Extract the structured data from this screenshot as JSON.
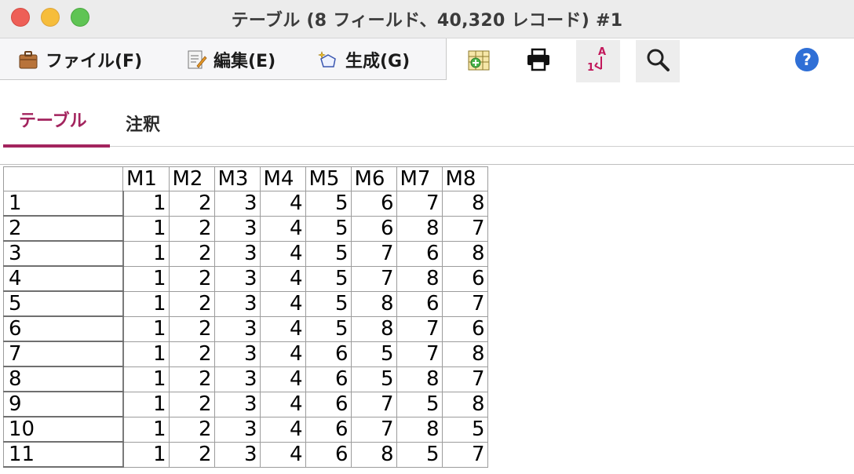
{
  "window": {
    "title": "テーブル (8 フィールド、40,320 レコード) #1"
  },
  "menu": {
    "file_label": "ファイル(F)",
    "edit_label": "編集(E)",
    "generate_label": "生成(G)"
  },
  "toolbar_icons": [
    "export-table-icon",
    "print-icon",
    "sort-icon",
    "search-icon",
    "help-icon"
  ],
  "tabs": [
    {
      "label": "テーブル",
      "active": true
    },
    {
      "label": "注釈",
      "active": false
    }
  ],
  "table": {
    "columns": [
      "M1",
      "M2",
      "M3",
      "M4",
      "M5",
      "M6",
      "M7",
      "M8"
    ],
    "rows": [
      {
        "label": "1",
        "values": [
          "1",
          "2",
          "3",
          "4",
          "5",
          "6",
          "7",
          "8"
        ]
      },
      {
        "label": "2",
        "values": [
          "1",
          "2",
          "3",
          "4",
          "5",
          "6",
          "8",
          "7"
        ]
      },
      {
        "label": "3",
        "values": [
          "1",
          "2",
          "3",
          "4",
          "5",
          "7",
          "6",
          "8"
        ]
      },
      {
        "label": "4",
        "values": [
          "1",
          "2",
          "3",
          "4",
          "5",
          "7",
          "8",
          "6"
        ]
      },
      {
        "label": "5",
        "values": [
          "1",
          "2",
          "3",
          "4",
          "5",
          "8",
          "6",
          "7"
        ]
      },
      {
        "label": "6",
        "values": [
          "1",
          "2",
          "3",
          "4",
          "5",
          "8",
          "7",
          "6"
        ]
      },
      {
        "label": "7",
        "values": [
          "1",
          "2",
          "3",
          "4",
          "6",
          "5",
          "7",
          "8"
        ]
      },
      {
        "label": "8",
        "values": [
          "1",
          "2",
          "3",
          "4",
          "6",
          "5",
          "8",
          "7"
        ]
      },
      {
        "label": "9",
        "values": [
          "1",
          "2",
          "3",
          "4",
          "6",
          "7",
          "5",
          "8"
        ]
      },
      {
        "label": "10",
        "values": [
          "1",
          "2",
          "3",
          "4",
          "6",
          "7",
          "8",
          "5"
        ]
      },
      {
        "label": "11",
        "values": [
          "1",
          "2",
          "3",
          "4",
          "6",
          "8",
          "5",
          "7"
        ]
      }
    ]
  },
  "colors": {
    "accent": "#a3245e",
    "help": "#2f6fd6"
  }
}
